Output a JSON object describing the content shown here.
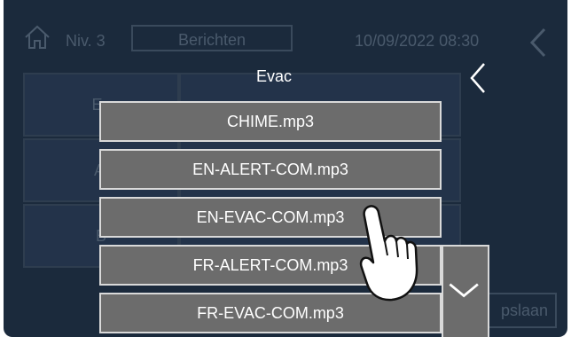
{
  "header": {
    "level_label": "Niv. 3",
    "messages_label": "Berichten",
    "datetime": "10/09/2022 08:30"
  },
  "background_tiles": [
    "Ev",
    "Al",
    "B"
  ],
  "dialog": {
    "title": "Evac",
    "items": [
      "CHIME.mp3",
      "EN-ALERT-COM.mp3",
      "EN-EVAC-COM.mp3",
      "FR-ALERT-COM.mp3",
      "FR-EVAC-COM.mp3"
    ]
  },
  "footer": {
    "save_label": "pslaan"
  },
  "icons": {
    "home": "home-icon",
    "back": "chevron-left-icon",
    "scroll": "chevron-down-icon",
    "hand": "hand-pointer-icon"
  },
  "colors": {
    "screen_bg": "#1b2a3c",
    "item_bg": "#6c6c6c",
    "item_border": "#d9d9d9",
    "text": "#ffffff"
  }
}
